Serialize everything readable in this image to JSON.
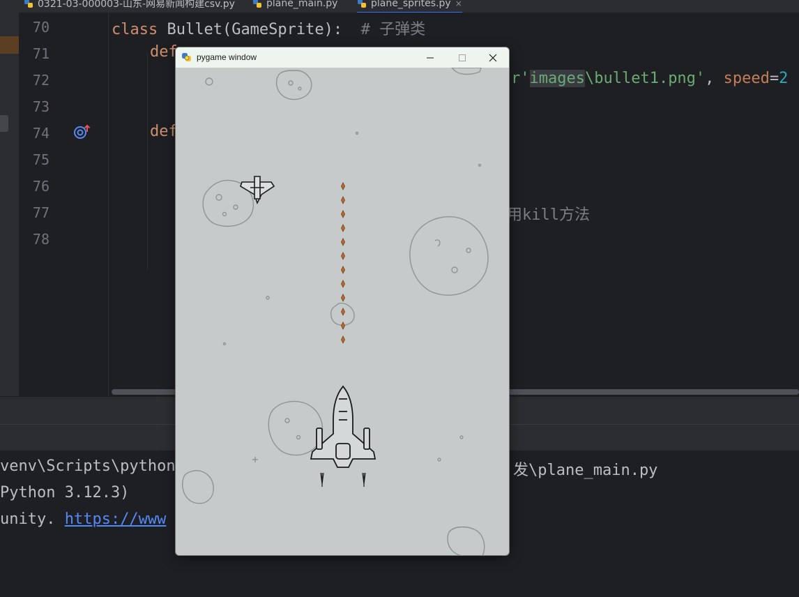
{
  "ide": {
    "tabs": [
      {
        "label": "0321-03-000003-山东-网易新闻构建csv.py"
      },
      {
        "label": "plane_main.py"
      },
      {
        "label": "plane_sprites.py",
        "close": "×"
      }
    ],
    "line_numbers": [
      "70",
      "71",
      "72",
      "73",
      "74",
      "75",
      "76",
      "77",
      "78"
    ],
    "code": {
      "l70_kw": "class",
      "l70_text": " Bullet(GameSprite):  ",
      "l70_comment": "# 子弹类",
      "l71_kw": "def",
      "l72_str_a": "r'",
      "l72_str_hl": "images",
      "l72_str_b": "\\bullet1.png'",
      "l72_comma": ", ",
      "l72_param": "speed",
      "l72_eq": "=",
      "l72_num": "2",
      "l74_kw": "def",
      "l77_comment": "用kill方法"
    },
    "console": {
      "line1_a": "venv\\Scripts\\python",
      "line1_b": "发\\plane_main.py",
      "line2": "Python 3.12.3)",
      "line3_prefix": "unity. ",
      "line3_link": "https://www"
    },
    "colors": {
      "accent": "#3574f0",
      "keyword": "#cf8e6d",
      "string": "#6aab73",
      "comment": "#7a7e85"
    }
  },
  "pygame_window": {
    "title": "pygame window",
    "buttons": [
      "minimize",
      "maximize",
      "close"
    ],
    "bullet_color": "#c06a2a",
    "background_color": "#c6cacb"
  }
}
